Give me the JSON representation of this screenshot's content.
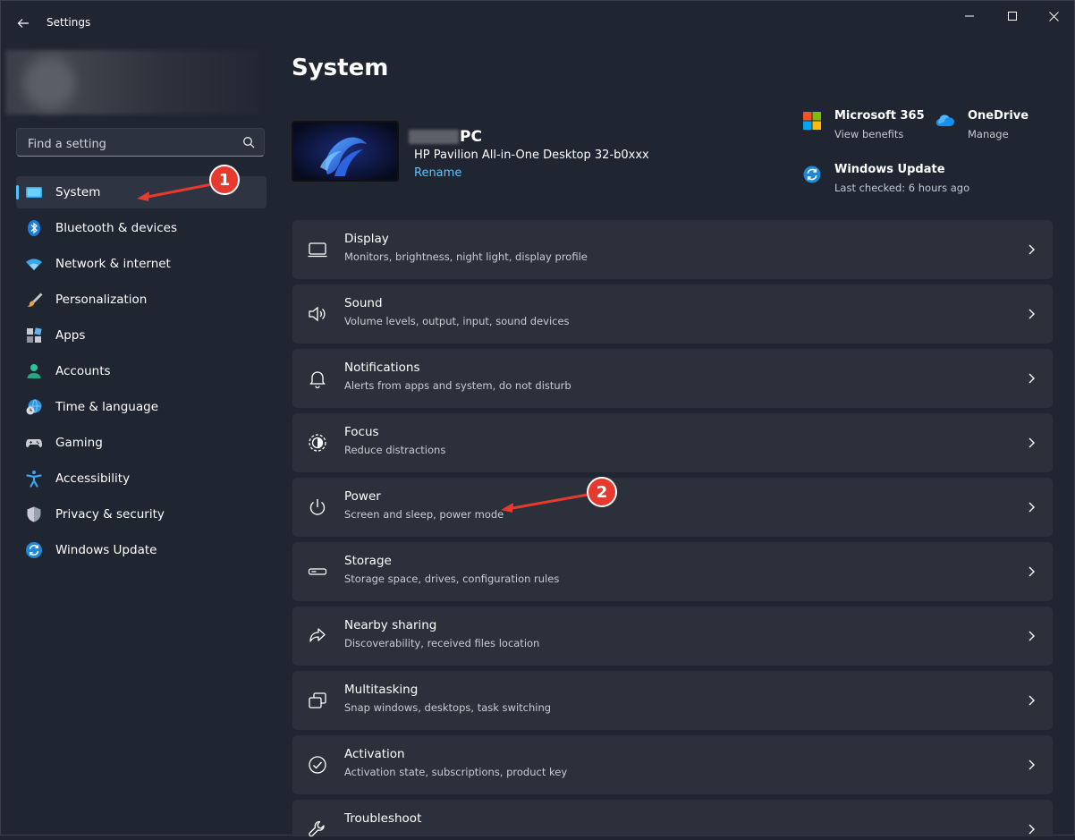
{
  "window": {
    "title": "Settings",
    "controls": [
      "minimize",
      "maximize",
      "close"
    ]
  },
  "sidebar": {
    "search_placeholder": "Find a setting",
    "items": [
      {
        "label": "System",
        "icon": "monitor-icon",
        "active": true
      },
      {
        "label": "Bluetooth & devices",
        "icon": "bluetooth-icon"
      },
      {
        "label": "Network & internet",
        "icon": "wifi-icon"
      },
      {
        "label": "Personalization",
        "icon": "brush-icon"
      },
      {
        "label": "Apps",
        "icon": "apps-icon"
      },
      {
        "label": "Accounts",
        "icon": "person-icon"
      },
      {
        "label": "Time & language",
        "icon": "globe-clock-icon"
      },
      {
        "label": "Gaming",
        "icon": "gamepad-icon"
      },
      {
        "label": "Accessibility",
        "icon": "accessibility-icon"
      },
      {
        "label": "Privacy & security",
        "icon": "shield-icon"
      },
      {
        "label": "Windows Update",
        "icon": "update-icon"
      }
    ]
  },
  "main": {
    "title": "System",
    "device": {
      "name_suffix": "PC",
      "model": "HP Pavilion All-in-One Desktop 32-b0xxx",
      "rename": "Rename"
    },
    "quick_links": [
      {
        "title": "Microsoft 365",
        "sub": "View benefits",
        "icon": "microsoft-logo-icon"
      },
      {
        "title": "OneDrive",
        "sub": "Manage",
        "icon": "onedrive-cloud-icon"
      },
      {
        "title": "Windows Update",
        "sub": "Last checked: 6 hours ago",
        "icon": "update-icon"
      }
    ],
    "cards": [
      {
        "title": "Display",
        "sub": "Monitors, brightness, night light, display profile",
        "icon": "display-icon"
      },
      {
        "title": "Sound",
        "sub": "Volume levels, output, input, sound devices",
        "icon": "speaker-icon"
      },
      {
        "title": "Notifications",
        "sub": "Alerts from apps and system, do not disturb",
        "icon": "bell-icon"
      },
      {
        "title": "Focus",
        "sub": "Reduce distractions",
        "icon": "focus-icon"
      },
      {
        "title": "Power",
        "sub": "Screen and sleep, power mode",
        "icon": "power-icon"
      },
      {
        "title": "Storage",
        "sub": "Storage space, drives, configuration rules",
        "icon": "storage-icon"
      },
      {
        "title": "Nearby sharing",
        "sub": "Discoverability, received files location",
        "icon": "share-icon"
      },
      {
        "title": "Multitasking",
        "sub": "Snap windows, desktops, task switching",
        "icon": "multitask-icon"
      },
      {
        "title": "Activation",
        "sub": "Activation state, subscriptions, product key",
        "icon": "check-circle-icon"
      },
      {
        "title": "Troubleshoot",
        "sub": "",
        "icon": "wrench-icon"
      }
    ]
  },
  "annotations": [
    {
      "number": "1",
      "target": "System"
    },
    {
      "number": "2",
      "target": "Power"
    }
  ],
  "colors": {
    "accent": "#4cc2ff",
    "background": "#202532",
    "card": "#2b303b",
    "annotation": "#e63a2e"
  }
}
